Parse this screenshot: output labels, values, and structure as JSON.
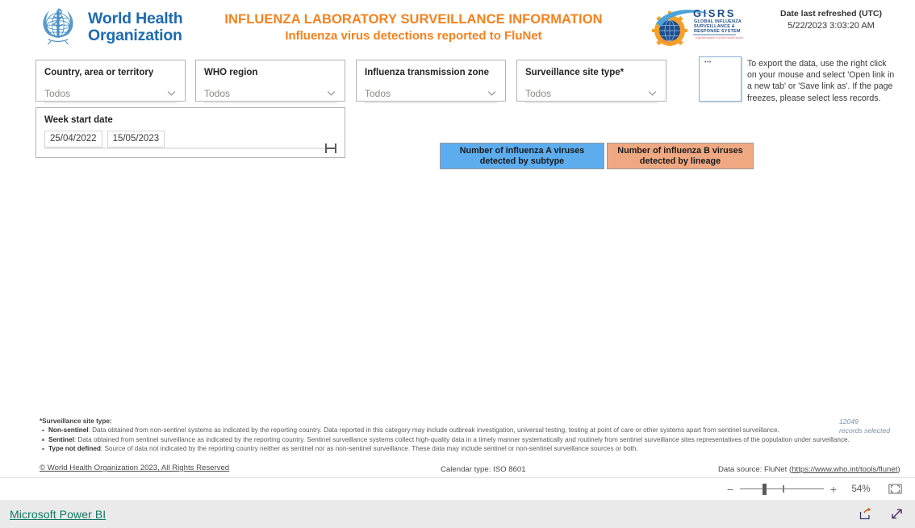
{
  "header": {
    "who_logo_alt": "who-emblem",
    "who_wordmark_line1": "World Health",
    "who_wordmark_line2": "Organization",
    "title_main": "INFLUENZA LABORATORY SURVEILLANCE INFORMATION",
    "title_sub": "Influenza virus detections reported to FluNet",
    "gisrs_acronym": "GISRS",
    "gisrs_line1": "GLOBAL INFLUENZA",
    "gisrs_line2": "SURVEILLANCE &",
    "gisrs_line3": "RESPONSE SYSTEM",
    "refresh_label": "Date last refreshed (UTC)",
    "refresh_value": "5/22/2023 3:03:20 AM",
    "title_color": "#F58220",
    "who_blue": "#1d6bb0"
  },
  "slicers": [
    {
      "title": "Country, area or territory",
      "value": "Todos"
    },
    {
      "title": "WHO region",
      "value": "Todos"
    },
    {
      "title": "Influenza transmission zone",
      "value": "Todos"
    },
    {
      "title": "Surveillance site type*",
      "value": "Todos"
    }
  ],
  "week_slicer": {
    "title": "Week start date",
    "start_date": "25/04/2022",
    "end_date": "15/05/2023"
  },
  "export": {
    "box_mark": "•••",
    "note": "To export the data, use the right click on your mouse and select 'Open link in a new tab' or 'Save link as'. If the page freezes, please select less records."
  },
  "nav_buttons": {
    "influenza_a": "Number of influenza A viruses detected by subtype",
    "influenza_b": "Number of influenza B viruses detected by lineage",
    "influenza_a_color": "#5DADEE",
    "influenza_b_color": "#EFA982"
  },
  "footnotes": {
    "heading": "*Surveillance site type:",
    "items": [
      {
        "term": "Non-sentinel",
        "text": ": Data obtained from non-sentinel systems as indicated by the reporting country. Data reported in this category may include outbreak investigation, universal testing, testing at point of care or other systems apart from sentinel surveillance."
      },
      {
        "term": "Sentinel",
        "text": ": Data obtained from sentinel surveillance as indicated by the reporting country. Sentinel surveillance systems collect high-quality data in a timely manner systematically and routinely from sentinel surveillance sites representatives of the population under surveillance."
      },
      {
        "term": "Type not defined",
        "text": ": Source of data not indicated by the reporting country neither as sentinel nor as non-sentinel surveillance. These data may include sentinel or non-sentinel surveillance sources or both."
      }
    ]
  },
  "records": {
    "count": "12049",
    "label": "records selected"
  },
  "report_footer": {
    "copyright": "© World Health Organization 2023, All Rights Reserved",
    "calendar_type": "Calendar type: ISO 8601",
    "datasource_prefix": "Data source: FluNet (",
    "datasource_link": "https://www.who.int/tools/flunet",
    "datasource_suffix": ")"
  },
  "zoom_bar": {
    "minus": "−",
    "plus": "+",
    "percent": "54%",
    "fit_icon": "fit-to-page-icon"
  },
  "pbi_footer": {
    "brand": "Microsoft Power BI",
    "share_icon": "share-icon",
    "fullscreen_icon": "fullscreen-icon"
  }
}
